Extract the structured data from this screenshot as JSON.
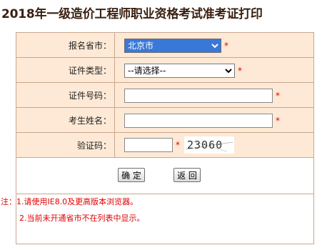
{
  "page": {
    "title": "2018年一级造价工程师职业资格考试准考证打印"
  },
  "form": {
    "province": {
      "label": "报名省市：",
      "selected": "北京市",
      "required": "*"
    },
    "id_type": {
      "label": "证件类型：",
      "selected": "--请选择--",
      "required": "*"
    },
    "id_number": {
      "label": "证件号码：",
      "value": "",
      "required": "*"
    },
    "name": {
      "label": "考生姓名：",
      "value": "",
      "required": "*"
    },
    "captcha": {
      "label": "验证码：",
      "value": "",
      "required": "*",
      "image_text": "23060"
    }
  },
  "buttons": {
    "confirm": "确 定",
    "back": "返 回"
  },
  "notes": {
    "line1": "注：1.请使用IE8.0及更高版本浏览器。",
    "line2": "2.当前未开通省市不在列表中显示。"
  },
  "colors": {
    "row_bg": "#fde9d5",
    "border": "#c9a78e",
    "required": "#e00000",
    "select_highlight": "#3a78d8"
  }
}
